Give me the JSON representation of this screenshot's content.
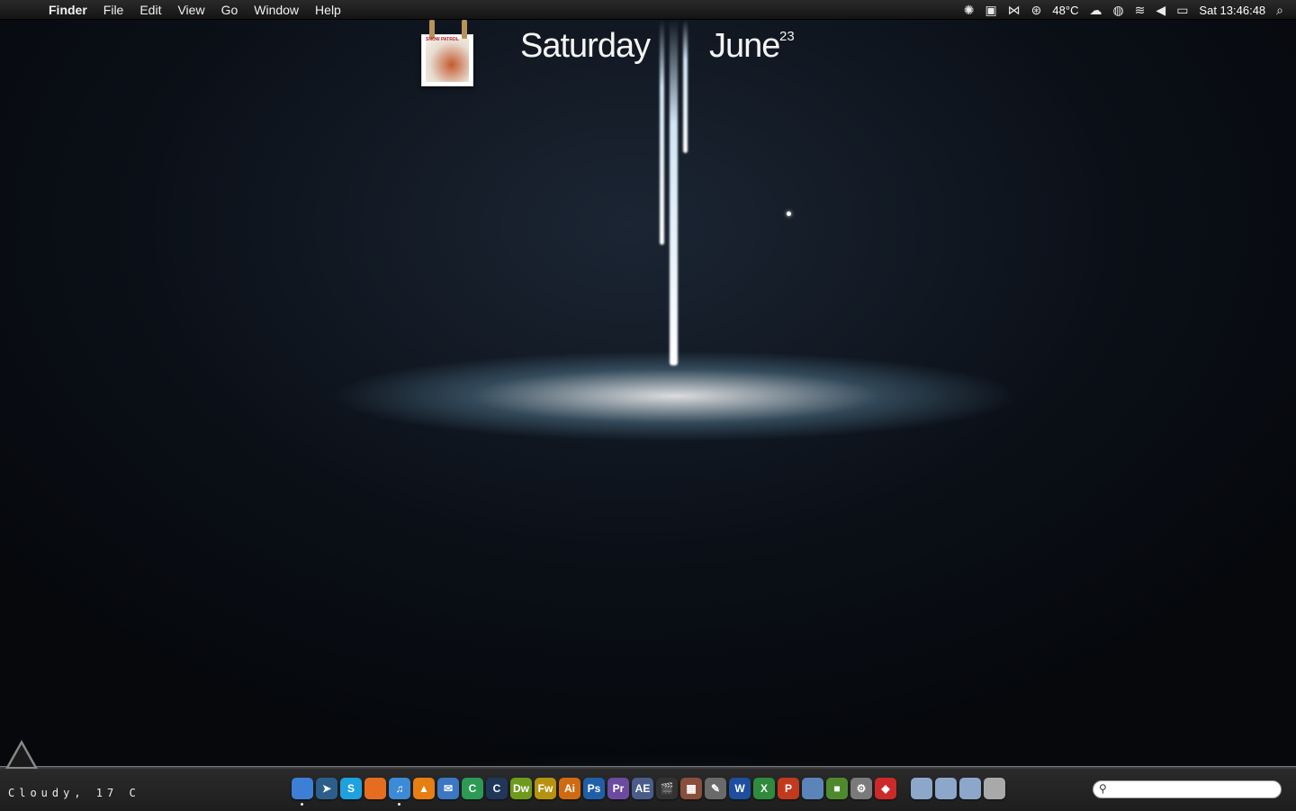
{
  "menubar": {
    "apple_icon": "apple-icon",
    "app_name": "Finder",
    "menus": [
      "File",
      "Edit",
      "View",
      "Go",
      "Window",
      "Help"
    ],
    "status": {
      "temperature": "48°C",
      "clock": "Sat 13:46:48"
    }
  },
  "widget": {
    "day": "Saturday",
    "month": "June",
    "date": "23",
    "album_title": "SNOW PATROL"
  },
  "weather": {
    "text": "Cloudy,  17  C"
  },
  "dock": {
    "apps": [
      {
        "name": "finder",
        "label": "",
        "color": "#3d7fd6",
        "running": true
      },
      {
        "name": "cursor",
        "label": "➤",
        "color": "#2c5e8c",
        "running": false
      },
      {
        "name": "skype",
        "label": "S",
        "color": "#1ea1dc",
        "running": false
      },
      {
        "name": "firefox",
        "label": "",
        "color": "#e66d1f",
        "running": false
      },
      {
        "name": "itunes",
        "label": "♫",
        "color": "#3d8ad6",
        "running": true
      },
      {
        "name": "vlc",
        "label": "▲",
        "color": "#e67e12",
        "running": false
      },
      {
        "name": "mail",
        "label": "✉",
        "color": "#3b77c2",
        "running": false
      },
      {
        "name": "chrome-c",
        "label": "C",
        "color": "#2c9a54",
        "running": false
      },
      {
        "name": "cinema",
        "label": "C",
        "color": "#20375a",
        "running": false
      },
      {
        "name": "dreamweaver",
        "label": "Dw",
        "color": "#6e9a1e",
        "running": false
      },
      {
        "name": "fireworks",
        "label": "Fw",
        "color": "#b59210",
        "running": false
      },
      {
        "name": "illustrator",
        "label": "Ai",
        "color": "#d06a12",
        "running": false
      },
      {
        "name": "photoshop",
        "label": "Ps",
        "color": "#1f5fa8",
        "running": false
      },
      {
        "name": "premiere",
        "label": "Pr",
        "color": "#6c4aa0",
        "running": false
      },
      {
        "name": "after-effects",
        "label": "AE",
        "color": "#4a5d8a",
        "running": false
      },
      {
        "name": "final-cut",
        "label": "🎬",
        "color": "#333333",
        "running": false
      },
      {
        "name": "photo-app",
        "label": "▦",
        "color": "#8a4f3c",
        "running": false
      },
      {
        "name": "design-app",
        "label": "✎",
        "color": "#6a6a6a",
        "running": false
      },
      {
        "name": "word",
        "label": "W",
        "color": "#1d4f9e",
        "running": false
      },
      {
        "name": "excel",
        "label": "X",
        "color": "#2f8a3c",
        "running": false
      },
      {
        "name": "powerpoint",
        "label": "P",
        "color": "#c23a1e",
        "running": false
      },
      {
        "name": "system-app",
        "label": "",
        "color": "#5b84b8",
        "running": false
      },
      {
        "name": "minecraft",
        "label": "■",
        "color": "#4e8a2d",
        "running": false
      },
      {
        "name": "system-preferences",
        "label": "⚙",
        "color": "#7a7a7a",
        "running": false
      },
      {
        "name": "red-app",
        "label": "◆",
        "color": "#cc2a2a",
        "running": false
      }
    ],
    "stacks": [
      {
        "name": "applications-folder",
        "color": "#8ca7c9"
      },
      {
        "name": "documents-folder",
        "color": "#8ca7c9"
      },
      {
        "name": "downloads-folder",
        "color": "#8ca7c9"
      },
      {
        "name": "trash",
        "color": "#a9a9a9"
      }
    ]
  },
  "spotlight": {
    "placeholder": ""
  }
}
